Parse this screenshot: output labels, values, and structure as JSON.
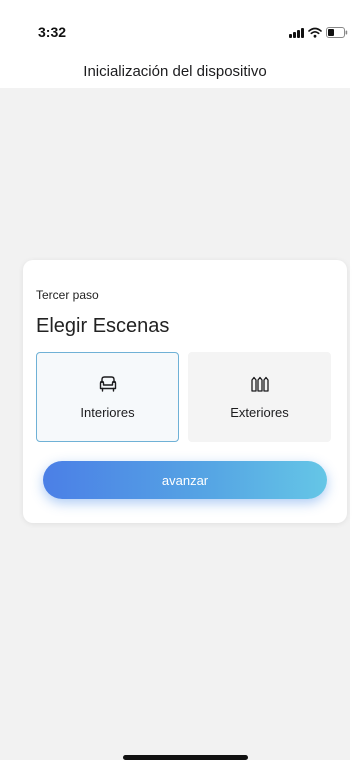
{
  "status_bar": {
    "time": "3:32",
    "icons": [
      "cellular-signal-icon",
      "wifi-icon",
      "battery-icon"
    ]
  },
  "header": {
    "title": "Inicialización del dispositivo"
  },
  "card": {
    "step_label": "Tercer paso",
    "title": "Elegir Escenas",
    "options": [
      {
        "label": "Interiores",
        "icon": "sofa-icon",
        "selected": true
      },
      {
        "label": "Exteriores",
        "icon": "fence-icon",
        "selected": false
      }
    ],
    "advance_label": "avanzar"
  },
  "colors": {
    "background": "#f2f2f2",
    "card": "#ffffff",
    "selected_border": "#6fb1d6",
    "button_gradient_start": "#4b7fe6",
    "button_gradient_end": "#65c6e6"
  }
}
